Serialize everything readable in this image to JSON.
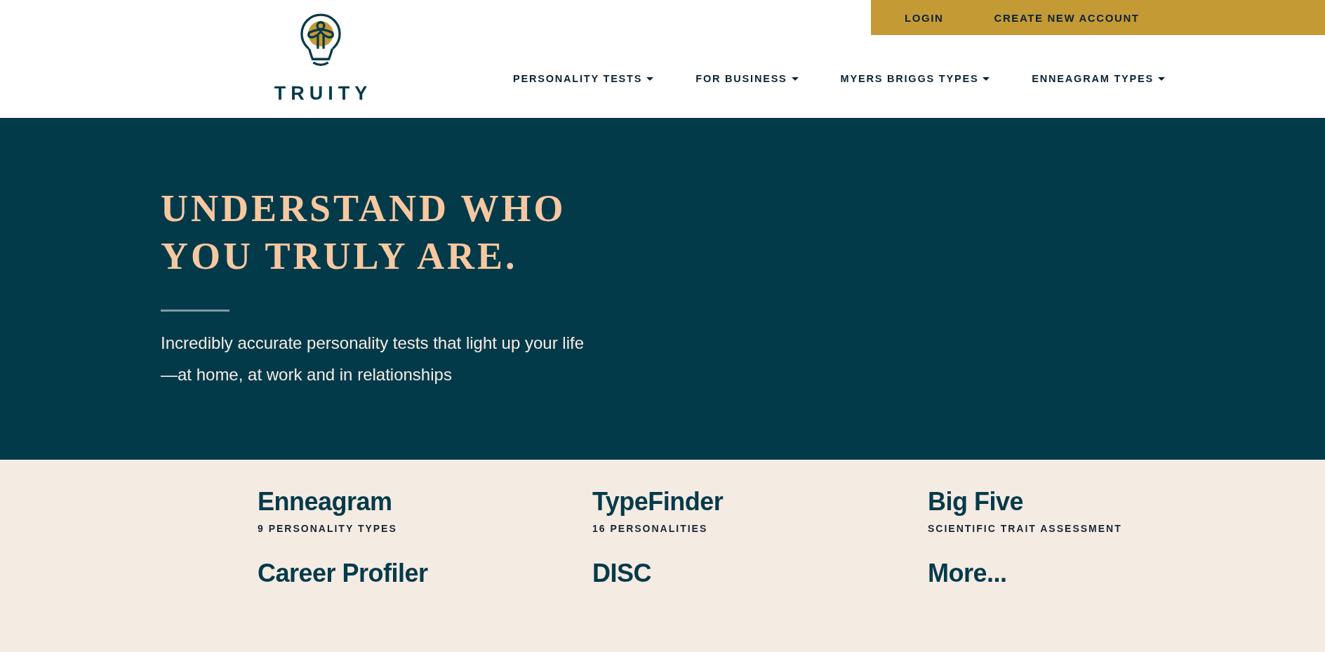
{
  "header": {
    "logo_text": "TRUITY",
    "account_links": [
      "LOGIN",
      "CREATE NEW ACCOUNT"
    ],
    "nav": [
      "PERSONALITY TESTS",
      "FOR BUSINESS",
      "MYERS BRIGGS TYPES",
      "ENNEAGRAM TYPES"
    ]
  },
  "hero": {
    "heading_lines": [
      "UNDERSTAND WHO",
      "YOU TRULY ARE."
    ],
    "subtitle": "Incredibly accurate personality tests that light up your life—at home, at work and in relationships"
  },
  "tests": [
    {
      "name": "Enneagram",
      "tagline": "9 PERSONALITY TYPES"
    },
    {
      "name": "TypeFinder",
      "tagline": "16 PERSONALITIES"
    },
    {
      "name": "Big Five",
      "tagline": "SCIENTIFIC TRAIT ASSESSMENT"
    },
    {
      "name": "Career Profiler"
    },
    {
      "name": "DISC"
    },
    {
      "name": "More..."
    }
  ]
}
